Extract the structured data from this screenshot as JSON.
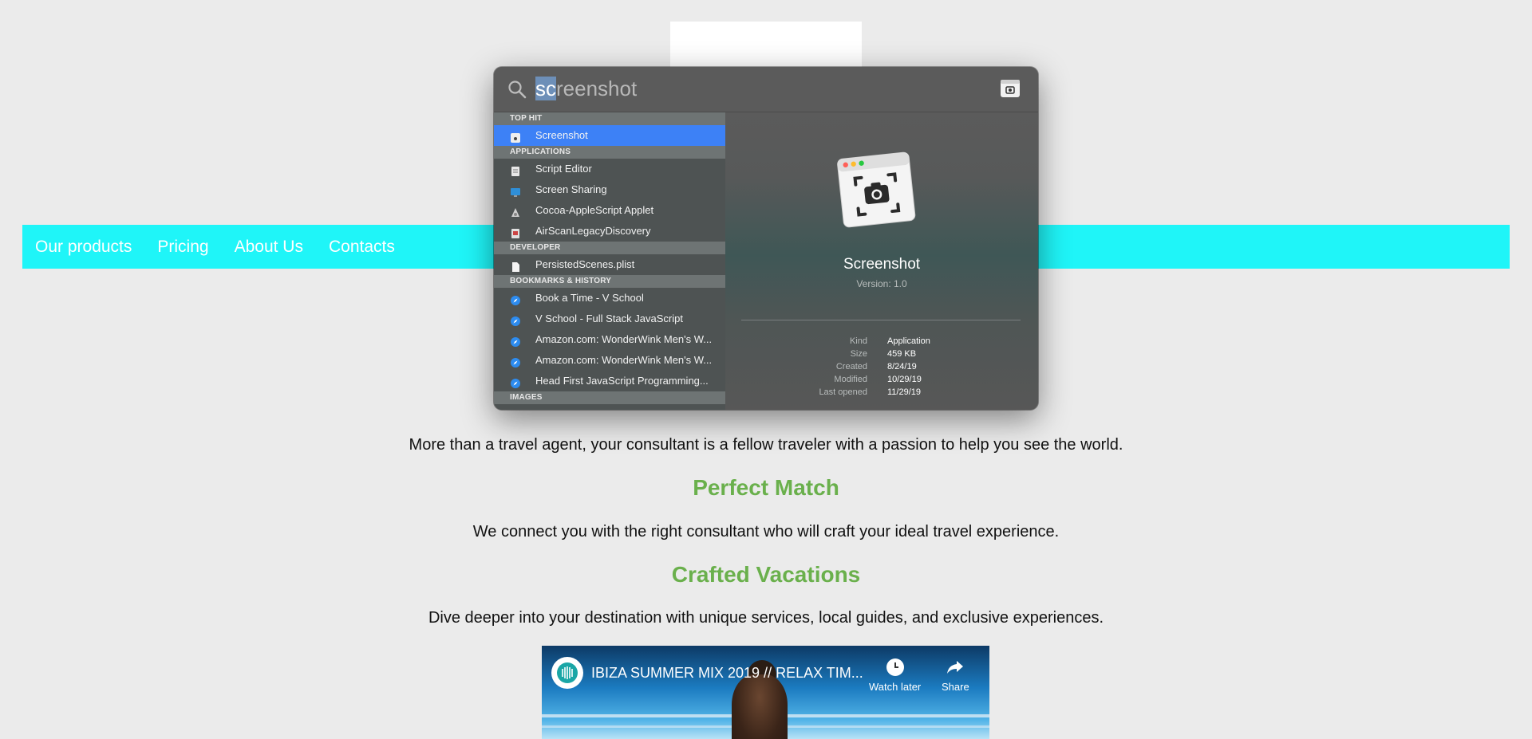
{
  "nav": {
    "items": [
      {
        "label": "Our products"
      },
      {
        "label": "Pricing"
      },
      {
        "label": "About Us"
      },
      {
        "label": "Contacts"
      }
    ]
  },
  "content": {
    "para1": "More than a travel agent, your consultant is a fellow traveler with a passion to help you see the world.",
    "heading2": "Perfect Match",
    "para2": "We connect you with the right consultant who will craft your ideal travel experience.",
    "heading3": "Crafted Vacations",
    "para3": "Dive deeper into your destination with unique services, local guides, and exclusive experiences."
  },
  "video": {
    "title": "IBIZA SUMMER MIX 2019 // RELAX TIM...",
    "watch_later": "Watch later",
    "share": "Share"
  },
  "spotlight": {
    "query_selected": "sc",
    "query_rest": "reenshot",
    "sections": {
      "top_hit": "TOP HIT",
      "applications": "APPLICATIONS",
      "developer": "DEVELOPER",
      "bookmarks": "BOOKMARKS & HISTORY",
      "images": "IMAGES"
    },
    "top_hit": [
      {
        "label": "Screenshot",
        "icon": "screenshot-app-icon"
      }
    ],
    "applications": [
      {
        "label": "Script Editor",
        "icon": "script-editor-icon"
      },
      {
        "label": "Screen Sharing",
        "icon": "screen-sharing-icon"
      },
      {
        "label": "Cocoa-AppleScript Applet",
        "icon": "applescript-applet-icon"
      },
      {
        "label": "AirScanLegacyDiscovery",
        "icon": "airscan-icon"
      }
    ],
    "developer": [
      {
        "label": "PersistedScenes.plist",
        "icon": "document-icon"
      }
    ],
    "bookmarks": [
      {
        "label": "Book a Time - V School",
        "icon": "safari-icon"
      },
      {
        "label": "V School - Full Stack JavaScript",
        "icon": "safari-icon"
      },
      {
        "label": "Amazon.com: WonderWink Men's W...",
        "icon": "safari-icon"
      },
      {
        "label": "Amazon.com: WonderWink Men's W...",
        "icon": "safari-icon"
      },
      {
        "label": "Head First JavaScript Programming...",
        "icon": "safari-icon"
      }
    ],
    "preview": {
      "name": "Screenshot",
      "version": "Version: 1.0",
      "meta": [
        {
          "key": "Kind",
          "value": "Application"
        },
        {
          "key": "Size",
          "value": "459 KB"
        },
        {
          "key": "Created",
          "value": "8/24/19"
        },
        {
          "key": "Modified",
          "value": "10/29/19"
        },
        {
          "key": "Last opened",
          "value": "11/29/19"
        }
      ]
    }
  }
}
